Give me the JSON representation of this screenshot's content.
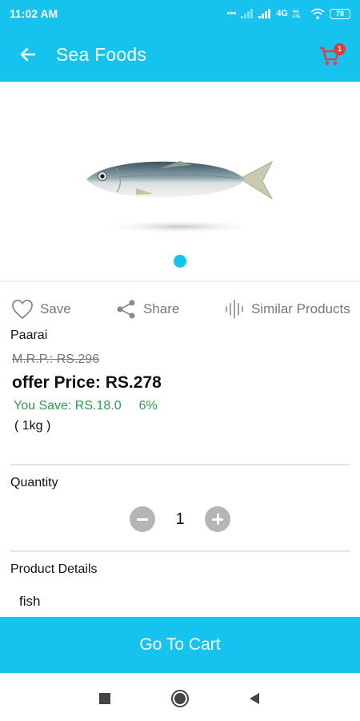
{
  "status_bar": {
    "time": "11:02 AM",
    "network": "4G",
    "battery": "78"
  },
  "app_bar": {
    "title": "Sea Foods",
    "cart_count": "1"
  },
  "product": {
    "image_icon": "fish-image",
    "carousel_dots": 1,
    "name": "Paarai",
    "mrp": "M.R.P.: RS.296",
    "offer_price": "offer Price: RS.278",
    "you_save": "You Save: RS.18.0",
    "discount": "6%",
    "unit": "( 1kg )"
  },
  "actions": {
    "save_label": "Save",
    "share_label": "Share",
    "similar_label": "Similar Products"
  },
  "quantity": {
    "label": "Quantity",
    "value": "1"
  },
  "details": {
    "label": "Product Details",
    "text": "fish"
  },
  "go_to_cart_label": "Go To Cart",
  "colors": {
    "accent": "#15c3ee",
    "savings": "#2e9b4a",
    "badge": "#e53935"
  }
}
